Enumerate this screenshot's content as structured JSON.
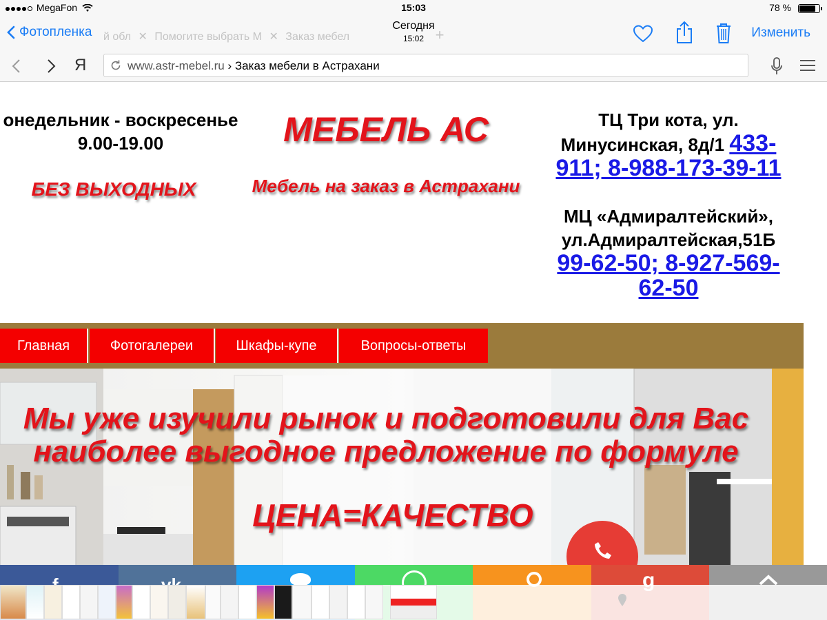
{
  "status": {
    "carrier": "MegaFon",
    "time": "15:03",
    "battery_text": "78 %",
    "battery_level": 0.78
  },
  "photos_bar": {
    "back_label": "Фотопленка",
    "title": "Сегодня",
    "subtitle": "15:02",
    "edit_label": "Изменить",
    "ghost_tab_1": "й обл",
    "ghost_tab_2": "Помогите выбрать М",
    "ghost_tab_3": "Заказ мебел"
  },
  "browser": {
    "domain": "www.astr-mebel.ru",
    "separator": "›",
    "page_title": "Заказ мебели в Астрахани"
  },
  "page": {
    "hours_days": "онедельник - воскресенье",
    "hours_time": "9.00-19.00",
    "no_days_off": "БЕЗ ВЫХОДНЫХ",
    "brand": "МЕБЕЛЬ АС",
    "tagline": "Мебель на заказ в Астрахани",
    "store1_line1": "ТЦ Три кота, ул.",
    "store1_line2": "Минусинская, 8д/1",
    "store1_phone_a": "433-",
    "store1_phone_b": "911; 8-988-173-39-11",
    "store2_line1": "МЦ «Адмиралтейский»,",
    "store2_line2": "ул.Адмиралтейская,51Б",
    "store2_phone_a": "99-62-50; 8-927-569-",
    "store2_phone_b": "62-50"
  },
  "menu": [
    "Главная",
    "Фотогалереи",
    "Шкафы-купе",
    "Вопросы-ответы"
  ],
  "hero": {
    "line1": "Мы уже изучили рынок и подготовили для Вас",
    "line2": "наиболее выгодное предложение по формуле",
    "line3": "ЦЕНА=КАЧЕСТВО"
  },
  "colors": {
    "ios_blue": "#1a7cf5",
    "brand_red": "#e3141b",
    "menu_red": "#f40000",
    "menu_band": "#9b7b3c",
    "link_blue": "#1a1ae6",
    "share_facebook": "#3b5998",
    "share_vk": "#507299",
    "share_twitter": "#1da1f2",
    "share_whatsapp": "#4cd964",
    "share_ok": "#f7931e",
    "share_google": "#dd4b39",
    "share_top": "#999999"
  },
  "share_icons": [
    "facebook-icon",
    "vk-icon",
    "twitter-icon",
    "whatsapp-icon",
    "odnoklassniki-icon",
    "google-plus-icon",
    "scroll-top-icon"
  ]
}
